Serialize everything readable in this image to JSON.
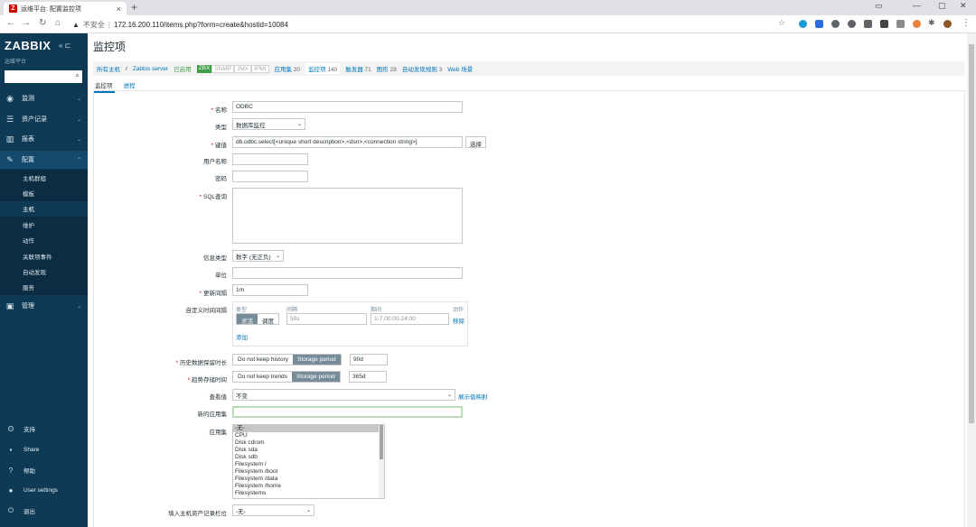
{
  "browser": {
    "tab_title": "运维平台: 配置监控项",
    "favicon_letter": "Z",
    "new_tab": "+",
    "insecure_label": "不安全",
    "url": "172.16.200.110/items.php?form=create&hostid=10084"
  },
  "sidebar": {
    "logo": "ZABBIX",
    "subtitle": "运维平台",
    "menu": [
      {
        "label": "监测",
        "icon": "eye-icon"
      },
      {
        "label": "资产记录",
        "icon": "list-icon"
      },
      {
        "label": "报表",
        "icon": "chart-icon"
      },
      {
        "label": "配置",
        "icon": "wrench-icon"
      },
      {
        "label": "管理",
        "icon": "admin-icon"
      }
    ],
    "config_sub": [
      "主机群组",
      "模板",
      "主机",
      "维护",
      "动作",
      "关联项事件",
      "自动发现",
      "服务"
    ],
    "bottom": [
      {
        "label": "支持",
        "icon": "support-icon"
      },
      {
        "label": "Share",
        "icon": "share-icon"
      },
      {
        "label": "帮助",
        "icon": "help-icon"
      },
      {
        "label": "User settings",
        "icon": "user-icon"
      },
      {
        "label": "退出",
        "icon": "power-icon"
      }
    ]
  },
  "main": {
    "title": "监控项",
    "breadcrumbs": {
      "all_hosts": "所有主机",
      "sep": "/",
      "host": "Zabbix server",
      "enabled": "已启用",
      "zbx": "ZBX",
      "snmp": "SNMP",
      "jmx": "JMX",
      "ipmi": "IPMI",
      "apps": "应用集",
      "apps_count": "20",
      "items": "监控项",
      "items_count": "140",
      "triggers": "触发器",
      "triggers_count": "71",
      "graphs": "图形",
      "graphs_count": "28",
      "discovery": "自动发现规则",
      "discovery_count": "3",
      "web": "Web 场景"
    },
    "tabs": [
      "监控项",
      "进程"
    ]
  },
  "form": {
    "name_label": "名称",
    "name_value": "ODBC",
    "type_label": "类型",
    "type_value": "数据库监控",
    "key_label": "键值",
    "key_value": "db.odbc.select[<unique short description>,<dsn>,<connection string>]",
    "select_btn": "选择",
    "user_label": "用户名称",
    "password_label": "密码",
    "sql_label": "SQL查询",
    "info_type_label": "信息类型",
    "info_type_value": "数字 (无正负)",
    "units_label": "单位",
    "interval_label": "更新间隔",
    "interval_value": "1m",
    "custom_label": "自定义时间间隔",
    "ci_type_head": "类型",
    "ci_interval_head": "间隔",
    "ci_period_head": "期间",
    "ci_action_head": "动作",
    "ci_flexible": "灵活",
    "ci_scheduling": "调度",
    "ci_interval_ph": "50s",
    "ci_period_ph": "1-7,00:00-24:00",
    "ci_remove": "移除",
    "ci_add": "添加",
    "history_label": "历史数据保留时长",
    "history_nokeep": "Do not keep history",
    "history_storage": "Storage period",
    "history_value": "90d",
    "trends_label": "趋势存储时间",
    "trends_nokeep": "Do not keep trends",
    "trends_storage": "Storage period",
    "trends_value": "365d",
    "valuemap_label": "查看值",
    "valuemap_value": "不变",
    "valuemap_link": "展示值映射",
    "newapp_label": "新的应用集",
    "apps_label": "应用集",
    "apps_options": [
      "-无-",
      "CPU",
      "Disk cdrom",
      "Disk sda",
      "Disk sdb",
      "Filesystem /",
      "Filesystem /boot",
      "Filesystem /data",
      "Filesystem /home",
      "Filesystems"
    ],
    "inventory_label": "填入主机资产记录栏位",
    "inventory_value": "-无-"
  }
}
